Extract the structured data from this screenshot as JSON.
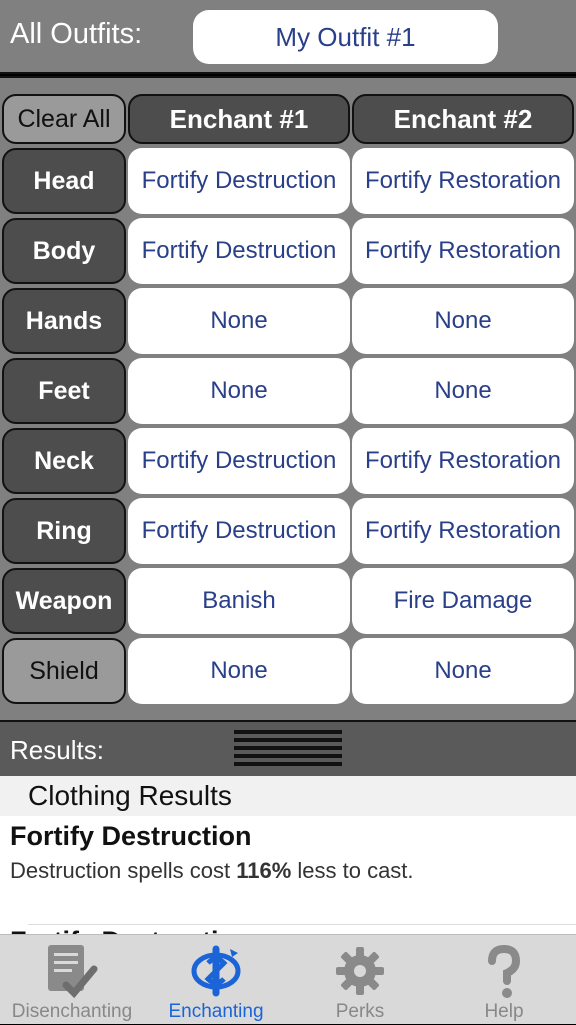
{
  "header": {
    "label": "All Outfits:",
    "outfit_name": "My Outfit #1"
  },
  "grid": {
    "clear_all": "Clear All",
    "enchant1_header": "Enchant #1",
    "enchant2_header": "Enchant #2",
    "rows": [
      {
        "slot": "Head",
        "e1": "Fortify Destruction",
        "e2": "Fortify Restoration"
      },
      {
        "slot": "Body",
        "e1": "Fortify Destruction",
        "e2": "Fortify Restoration"
      },
      {
        "slot": "Hands",
        "e1": "None",
        "e2": "None"
      },
      {
        "slot": "Feet",
        "e1": "None",
        "e2": "None"
      },
      {
        "slot": "Neck",
        "e1": "Fortify Destruction",
        "e2": "Fortify Restoration"
      },
      {
        "slot": "Ring",
        "e1": "Fortify Destruction",
        "e2": "Fortify Restoration"
      },
      {
        "slot": "Weapon",
        "e1": "Banish",
        "e2": "Fire Damage"
      },
      {
        "slot": "Shield",
        "e1": "None",
        "e2": "None"
      }
    ]
  },
  "results_bar": {
    "label": "Results:"
  },
  "results": {
    "section_title": "Clothing Results",
    "effects": [
      {
        "title": "Fortify Destruction",
        "desc_pre": "Destruction spells cost ",
        "desc_value": "116%",
        "desc_post": " less to cast."
      },
      {
        "title": "Fortify Destruction"
      }
    ]
  },
  "tabs": [
    {
      "label": "Disenchanting",
      "icon": "checklist-icon",
      "active": false
    },
    {
      "label": "Enchanting",
      "icon": "enchanting-swirl-icon",
      "active": true
    },
    {
      "label": "Perks",
      "icon": "gear-icon",
      "active": false
    },
    {
      "label": "Help",
      "icon": "question-mark-icon",
      "active": false
    }
  ],
  "colors": {
    "accent": "#1b64d8",
    "value_text": "#2a3f8a"
  }
}
